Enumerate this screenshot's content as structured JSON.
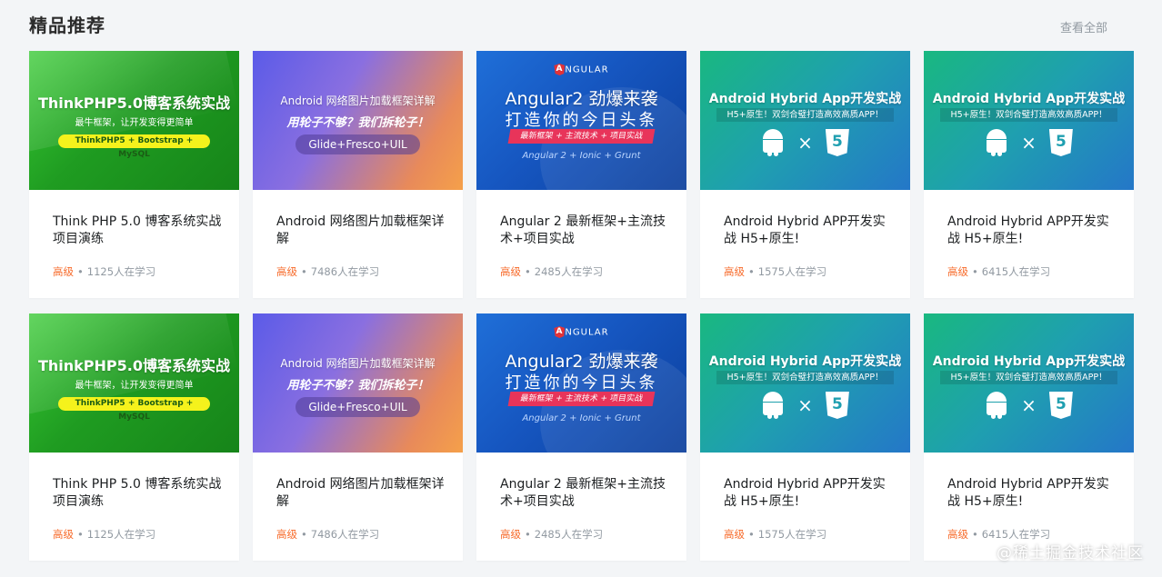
{
  "header": {
    "title": "精品推荐",
    "view_all": "查看全部"
  },
  "courses": [
    {
      "banner": {
        "style": "green",
        "title": "ThinkPHP5.0博客系统实战",
        "sub": "最牛框架，让开发变得更简单",
        "pill": "ThinkPHP5 + Bootstrap + MySQL"
      },
      "title": "Think PHP 5.0 博客系统实战项目演练",
      "level": "高级",
      "students": "1125人在学习"
    },
    {
      "banner": {
        "style": "purple",
        "title": "Android 网络图片加载框架详解",
        "sub": "用轮子不够？我们拆轮子！",
        "pill": "Glide+Fresco+UIL"
      },
      "title": "Android 网络图片加载框架详解",
      "level": "高级",
      "students": "7486人在学习"
    },
    {
      "banner": {
        "style": "blue",
        "logo": "NGULAR",
        "title": "Angular2 劲爆来袭",
        "sub": "打造你的今日头条",
        "pill": "最新框架 + 主流技术 + 项目实战",
        "foot": "Angular 2 + Ionic + Grunt"
      },
      "title": "Angular 2 最新框架+主流技术+项目实战",
      "level": "高级",
      "students": "2485人在学习"
    },
    {
      "banner": {
        "style": "teal",
        "title": "Android Hybrid App开发实战",
        "sub": "H5+原生！双剑合璧打造高效高质APP！"
      },
      "title": "Android Hybrid APP开发实战 H5+原生!",
      "level": "高级",
      "students": "1575人在学习"
    },
    {
      "banner": {
        "style": "teal",
        "title": "Android Hybrid App开发实战",
        "sub": "H5+原生！双剑合璧打造高效高质APP！"
      },
      "title": "Android Hybrid APP开发实战 H5+原生!",
      "level": "高级",
      "students": "6415人在学习"
    }
  ],
  "separator": "•",
  "watermark": "@稀土掘金技术社区"
}
